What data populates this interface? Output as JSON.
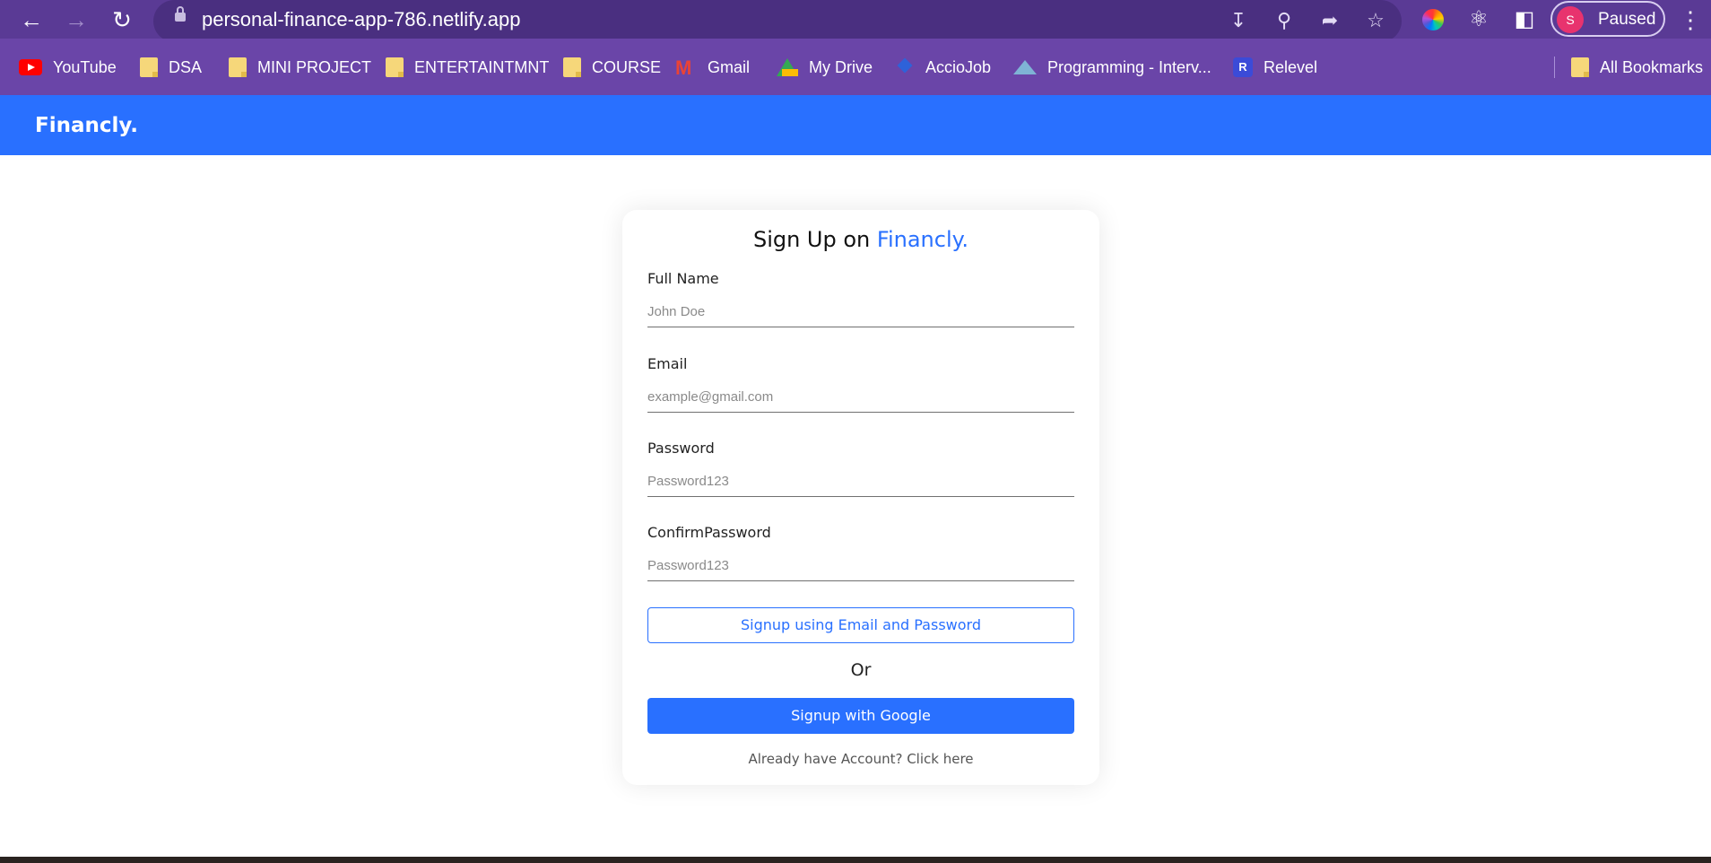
{
  "browser": {
    "url": "personal-finance-app-786.netlify.app",
    "profile": {
      "initial": "S",
      "label": "Paused"
    }
  },
  "bookmarks": [
    {
      "label": "YouTube",
      "icon": "youtube-icon"
    },
    {
      "label": "DSA",
      "icon": "folder-icon"
    },
    {
      "label": "MINI PROJECT",
      "icon": "folder-icon"
    },
    {
      "label": "ENTERTAINTMNT",
      "icon": "folder-icon"
    },
    {
      "label": "COURSE",
      "icon": "folder-icon"
    },
    {
      "label": "Gmail",
      "icon": "gmail-icon"
    },
    {
      "label": "My Drive",
      "icon": "drive-icon"
    },
    {
      "label": "AccioJob",
      "icon": "acciojob-icon"
    },
    {
      "label": "Programming - Interv...",
      "icon": "programming-icon"
    },
    {
      "label": "Relevel",
      "icon": "relevel-icon"
    }
  ],
  "all_bookmarks": {
    "label": "All Bookmarks",
    "icon": "folder-icon"
  },
  "app": {
    "brand": "Financly.",
    "accent_color": "#2970ff"
  },
  "signup": {
    "title_prefix": "Sign Up on",
    "title_brand": "Financly.",
    "fields": [
      {
        "label": "Full Name",
        "placeholder": "John Doe",
        "value": ""
      },
      {
        "label": "Email",
        "placeholder": "example@gmail.com",
        "value": ""
      },
      {
        "label": "Password",
        "placeholder": "Password123",
        "value": ""
      },
      {
        "label": "ConfirmPassword",
        "placeholder": "Password123",
        "value": ""
      }
    ],
    "email_button": "Signup using Email and Password",
    "or_text": "Or",
    "google_button": "Signup with Google",
    "login_link": "Already have Account? Click here"
  }
}
